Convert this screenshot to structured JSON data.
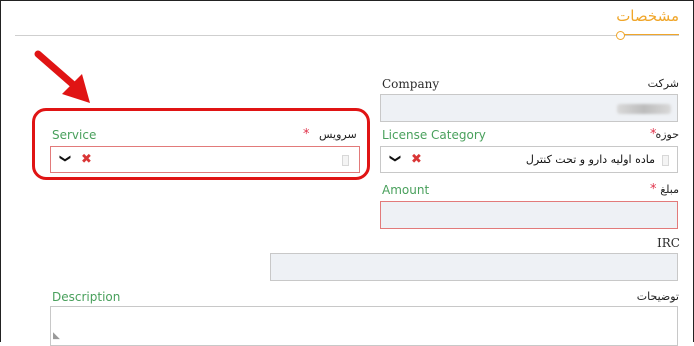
{
  "section": {
    "title": "مشخصات"
  },
  "fields": {
    "company": {
      "label_en": "Company",
      "label_fa": "شرکت"
    },
    "service": {
      "label_en": "Service",
      "label_fa": "سرویس",
      "required_mark": "*"
    },
    "license_category": {
      "label_en": "License Category",
      "label_fa": "حوزه",
      "required_mark": "*",
      "value": "ماده اولیه دارو و تحت کنترل"
    },
    "amount": {
      "label_en": "Amount",
      "label_fa": "مبلغ",
      "required_mark": "*"
    },
    "irc": {
      "label_en": "IRC"
    },
    "description": {
      "label_en": "Description",
      "label_fa": "توضیحات"
    }
  },
  "icons": {
    "dropdown": "chevron-down-icon",
    "clear": "clear-x-icon",
    "annotation": "red-arrow-icon"
  },
  "glyphs": {
    "chevron": "❯",
    "clear": "✖"
  },
  "colors": {
    "accent": "#f0a62a",
    "label_green": "#49a05c",
    "required": "#e0324a",
    "highlight": "#e01414"
  }
}
